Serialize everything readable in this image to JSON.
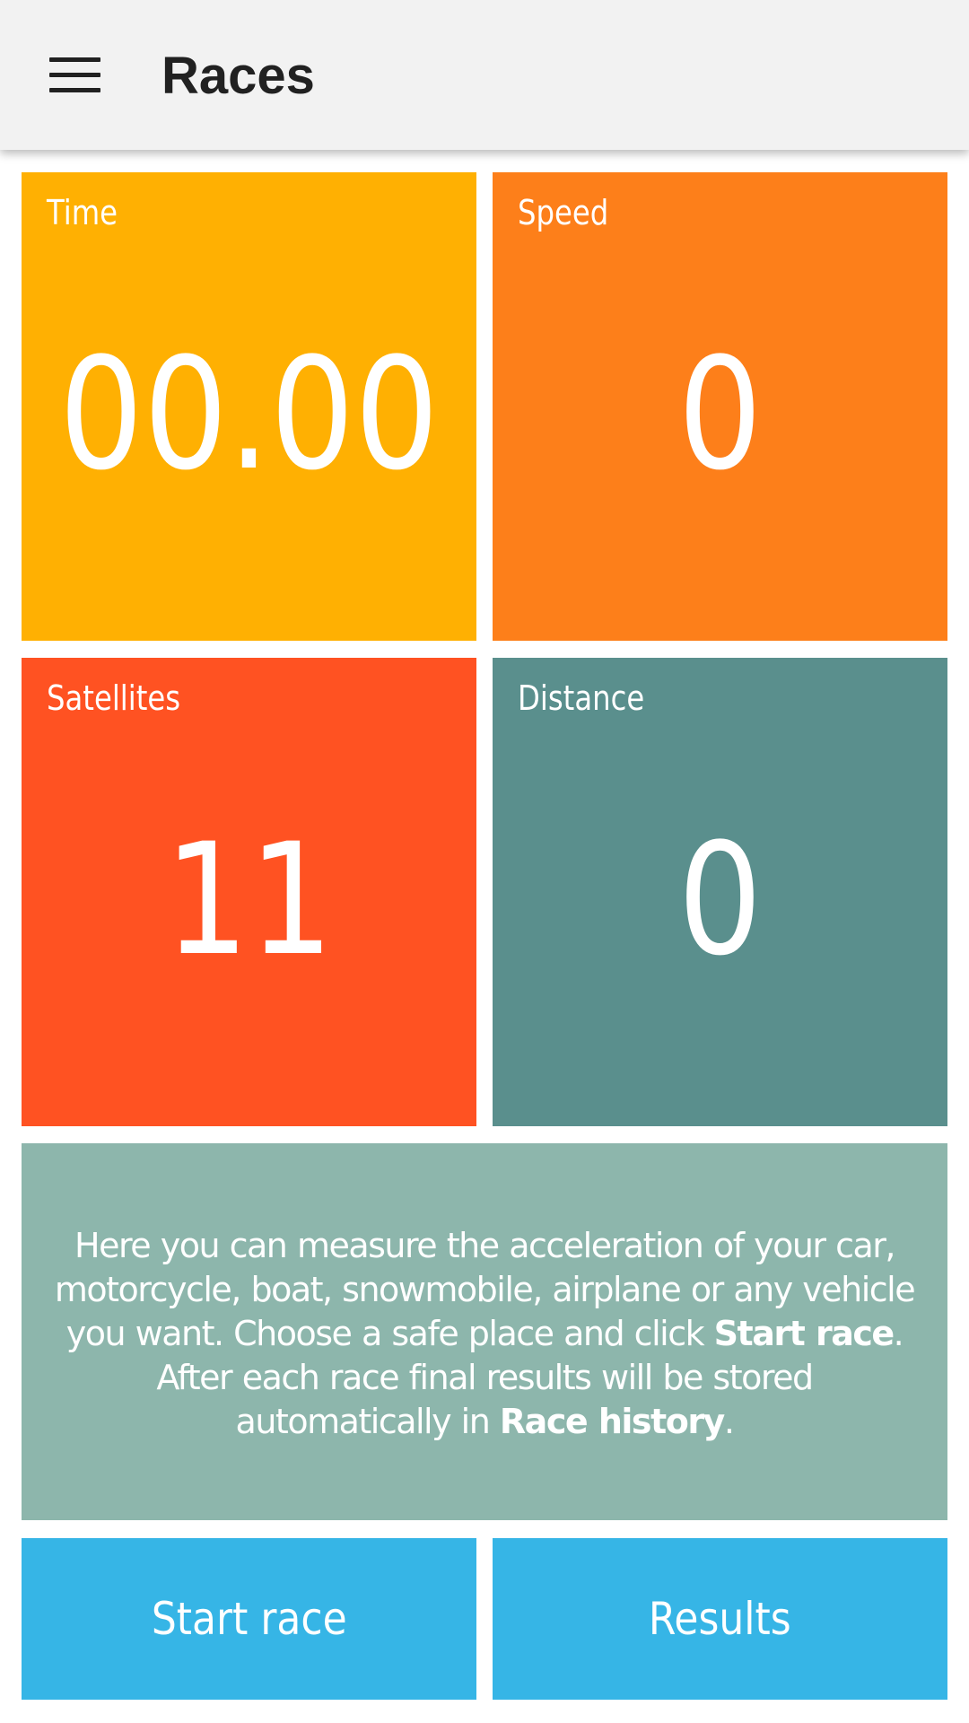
{
  "appbar": {
    "title": "Races",
    "menu_icon": "hamburger-menu-icon",
    "background": "#f2f2f2"
  },
  "tiles": {
    "time": {
      "label": "Time",
      "value": "00.00",
      "color": "#ffb002"
    },
    "speed": {
      "label": "Speed",
      "value": "0",
      "color": "#fd7f1a"
    },
    "satellites": {
      "label": "Satellites",
      "value": "11",
      "color": "#ff5222"
    },
    "distance": {
      "label": "Distance",
      "value": "0",
      "color": "#5a8f8d"
    }
  },
  "info": {
    "text_1": "Here you can measure the acceleration of your car, motorcycle, boat, snowmobile, airplane or any vehicle you want. Choose a safe place and click ",
    "bold_1": "Start race",
    "text_2": ". After each race final results will be stored automatically in ",
    "bold_2": "Race history",
    "text_3": ".",
    "color": "#8db6ac"
  },
  "buttons": {
    "start_label": "Start race",
    "results_label": "Results",
    "color": "#36b5e6"
  }
}
